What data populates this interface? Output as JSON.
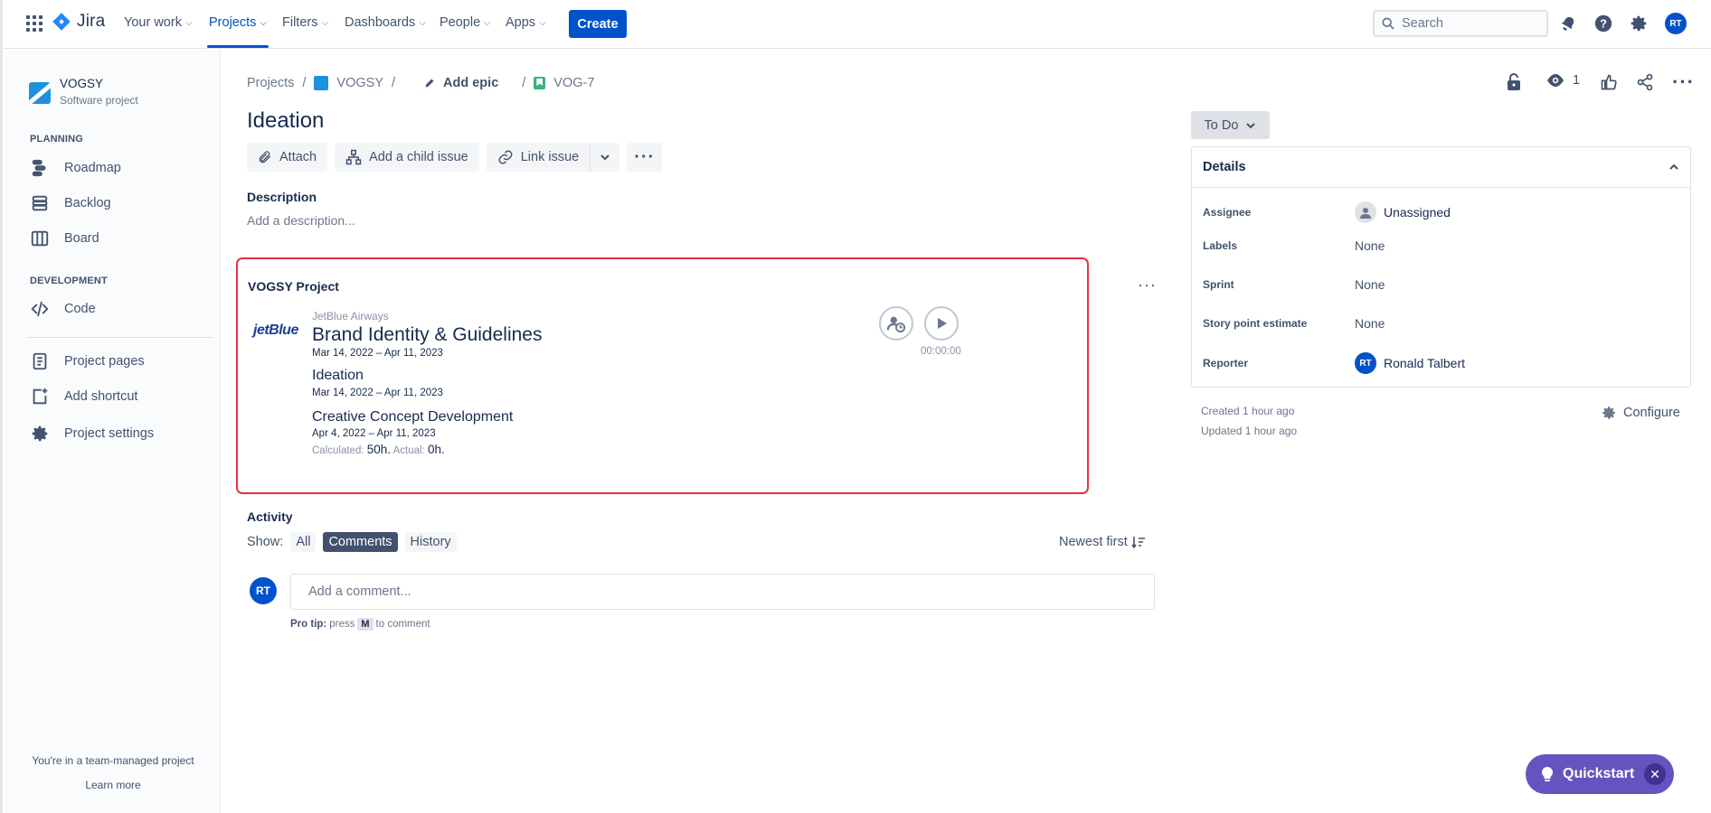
{
  "nav": {
    "app_name": "Jira",
    "items": [
      {
        "label": "Your work"
      },
      {
        "label": "Projects"
      },
      {
        "label": "Filters"
      },
      {
        "label": "Dashboards"
      },
      {
        "label": "People"
      },
      {
        "label": "Apps"
      }
    ],
    "active_item": "Projects",
    "create_label": "Create",
    "search_placeholder": "Search",
    "user_initials": "RT"
  },
  "sidebar": {
    "project_name": "VOGSY",
    "project_type": "Software project",
    "planning_header": "PLANNING",
    "planning_items": [
      {
        "label": "Roadmap"
      },
      {
        "label": "Backlog"
      },
      {
        "label": "Board"
      }
    ],
    "development_header": "DEVELOPMENT",
    "development_items": [
      {
        "label": "Code"
      }
    ],
    "other_items": [
      {
        "label": "Project pages"
      },
      {
        "label": "Add shortcut"
      },
      {
        "label": "Project settings"
      }
    ],
    "footer_text": "You're in a team-managed project",
    "footer_link": "Learn more"
  },
  "breadcrumb": {
    "projects": "Projects",
    "project": "VOGSY",
    "add_epic": "Add epic",
    "issue_key": "VOG-7"
  },
  "issue": {
    "title": "Ideation",
    "watchers": "1",
    "actions": {
      "attach": "Attach",
      "add_child": "Add a child issue",
      "link_issue": "Link issue"
    },
    "description_label": "Description",
    "description_placeholder": "Add a description..."
  },
  "vogsy_panel": {
    "title": "VOGSY Project",
    "client_logo": "jetBlue",
    "client": "JetBlue Airways",
    "project": "Brand Identity & Guidelines",
    "project_dates": "Mar 14, 2022 – Apr 11, 2023",
    "phase": "Ideation",
    "phase_dates": "Mar 14, 2022 – Apr 11, 2023",
    "subphase": "Creative Concept Development",
    "subphase_dates": "Apr 4, 2022 – Apr 11, 2023",
    "calculated_label": "Calculated:",
    "calculated_value": "50h.",
    "actual_label": "Actual:",
    "actual_value": "0h.",
    "timer": "00:00:00"
  },
  "activity": {
    "label": "Activity",
    "show_label": "Show:",
    "filters": [
      "All",
      "Comments",
      "History"
    ],
    "selected_filter": "Comments",
    "sort_label": "Newest first",
    "comment_placeholder": "Add a comment...",
    "protip_bold": "Pro tip:",
    "protip_press": "press",
    "protip_key": "M",
    "protip_suffix": "to comment"
  },
  "details": {
    "status": "To Do",
    "header": "Details",
    "rows": [
      {
        "label": "Assignee",
        "value": "Unassigned"
      },
      {
        "label": "Labels",
        "value": "None"
      },
      {
        "label": "Sprint",
        "value": "None"
      },
      {
        "label": "Story point estimate",
        "value": "None"
      },
      {
        "label": "Reporter",
        "value": "Ronald Talbert",
        "initials": "RT"
      }
    ],
    "created": "Created 1 hour ago",
    "updated": "Updated 1 hour ago",
    "configure": "Configure"
  },
  "quickstart": {
    "label": "Quickstart"
  },
  "colors": {
    "brand_blue": "#0052cc",
    "highlight_red": "#e8303c",
    "quickstart_purple": "#6554c0"
  }
}
